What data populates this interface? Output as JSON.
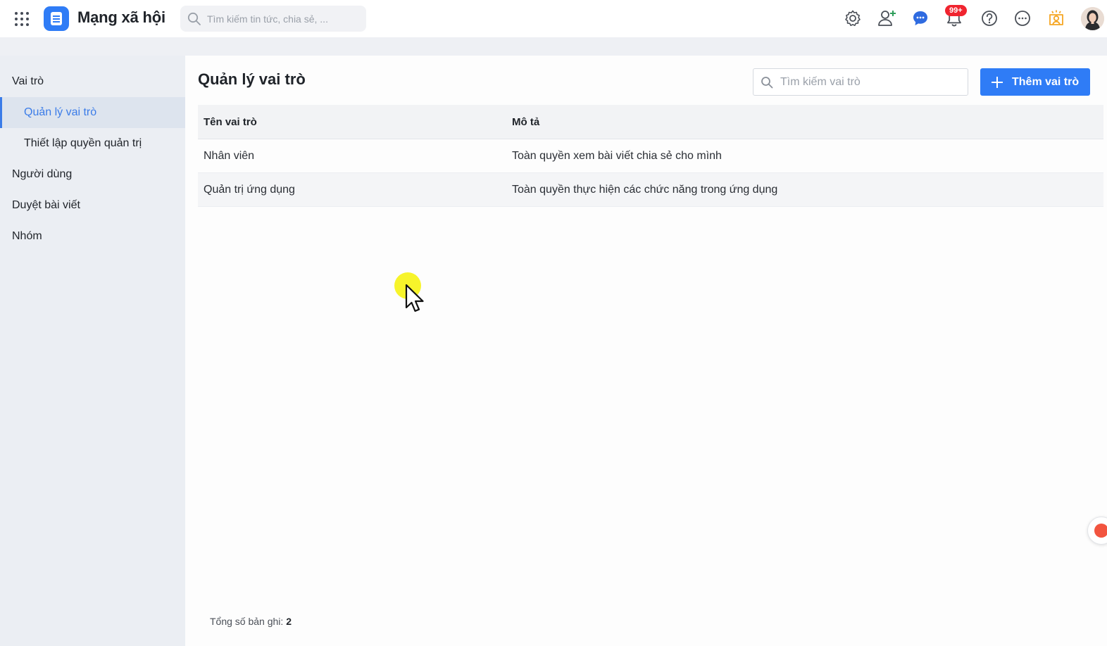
{
  "header": {
    "app_title": "Mạng xã hội",
    "search_placeholder": "Tìm kiếm tin tức, chia sẻ, ...",
    "notification_badge": "99+",
    "icons": [
      "apps-grid-icon",
      "settings-icon",
      "add-user-icon",
      "chat-icon",
      "bell-icon",
      "help-icon",
      "more-icon",
      "badge-icon",
      "avatar"
    ],
    "colors": {
      "accent": "#2f7cf6",
      "badge": "#f0242f",
      "award": "#f5a623"
    }
  },
  "sidebar": {
    "items": [
      {
        "label": "Vai trò",
        "level": 1,
        "active": false
      },
      {
        "label": "Quản lý vai trò",
        "level": 2,
        "active": true
      },
      {
        "label": "Thiết lập quyền quản trị",
        "level": 2,
        "active": false
      },
      {
        "label": "Người dùng",
        "level": 1,
        "active": false
      },
      {
        "label": "Duyệt bài viết",
        "level": 1,
        "active": false
      },
      {
        "label": "Nhóm",
        "level": 1,
        "active": false
      }
    ]
  },
  "main": {
    "title": "Quản lý vai trò",
    "search_placeholder": "Tìm kiếm vai trò",
    "add_button_label": "Thêm vai trò",
    "table": {
      "columns": [
        "Tên vai trò",
        "Mô tả"
      ],
      "rows": [
        {
          "name": "Nhân viên",
          "description": "Toàn quyền xem bài viết chia sẻ cho mình"
        },
        {
          "name": "Quản trị ứng dụng",
          "description": "Toàn quyền thực hiện các chức năng trong ứng dụng"
        }
      ]
    },
    "footer": {
      "total_label": "Tổng số bản ghi:",
      "total_value": "2"
    }
  }
}
